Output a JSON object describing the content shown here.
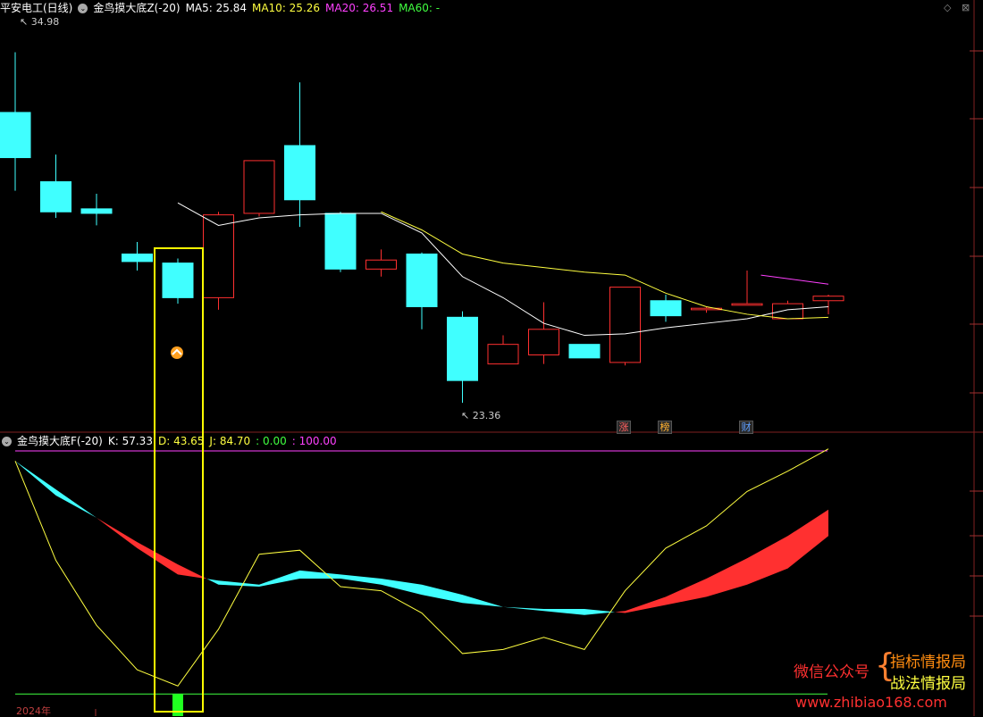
{
  "header": {
    "stock": "平安电工(日线)",
    "indicator": "金鸟摸大底Z(-20)",
    "ma5_label": "MA5: 25.84",
    "ma10_label": "MA10: 25.26",
    "ma20_label": "MA20: 26.51",
    "ma60_label": "MA60: -"
  },
  "sub_header": {
    "indicator": "金鸟摸大底F(-20)",
    "k_label": "K: 57.33",
    "d_label": "D: 43.65",
    "j_label": "J: 84.70",
    "zero_label": ": 0.00",
    "hundred_label": ": 100.00"
  },
  "price_labels": {
    "high": "34.98",
    "low": "23.36"
  },
  "badges": [
    {
      "text": "涨",
      "color": "#ff6060"
    },
    {
      "text": "榜",
      "color": "#ffb030"
    },
    {
      "text": "财",
      "color": "#60a0ff"
    }
  ],
  "date_label": "2024年",
  "watermark": {
    "wechat": "微信公众号",
    "line1": "指标情报局",
    "line2": "战法情报局",
    "url": "www.zhibiao168.com"
  },
  "colors": {
    "up": "#ff3030",
    "down": "#40ffff",
    "ma5": "#ffffff",
    "ma10": "#ffff40",
    "ma20": "#ff40ff",
    "ma60": "#40ff40",
    "highlight": "#ffff00"
  },
  "chart_data": {
    "type": "candlestick",
    "title": "平安电工(日线)",
    "ylim": [
      22.8,
      36.2
    ],
    "candles": [
      {
        "o": 33.0,
        "h": 35.0,
        "l": 30.4,
        "c": 31.5
      },
      {
        "o": 30.7,
        "h": 31.6,
        "l": 29.5,
        "c": 29.7
      },
      {
        "o": 29.8,
        "h": 30.3,
        "l": 29.25,
        "c": 29.65
      },
      {
        "o": 28.3,
        "h": 28.7,
        "l": 27.75,
        "c": 28.05
      },
      {
        "o": 28.0,
        "h": 28.15,
        "l": 26.65,
        "c": 26.85
      },
      {
        "o": 26.85,
        "h": 29.7,
        "l": 26.45,
        "c": 29.6
      },
      {
        "o": 29.65,
        "h": 31.4,
        "l": 29.55,
        "c": 31.4
      },
      {
        "o": 31.9,
        "h": 34.0,
        "l": 29.2,
        "c": 30.1
      },
      {
        "o": 29.65,
        "h": 29.7,
        "l": 27.7,
        "c": 27.8
      },
      {
        "o": 27.8,
        "h": 28.45,
        "l": 27.55,
        "c": 28.1
      },
      {
        "o": 28.3,
        "h": 28.35,
        "l": 25.8,
        "c": 26.55
      },
      {
        "o": 26.2,
        "h": 26.4,
        "l": 23.36,
        "c": 24.1
      },
      {
        "o": 24.65,
        "h": 25.6,
        "l": 24.65,
        "c": 25.3
      },
      {
        "o": 24.95,
        "h": 26.7,
        "l": 24.65,
        "c": 25.8
      },
      {
        "o": 25.3,
        "h": 25.3,
        "l": 24.85,
        "c": 24.85
      },
      {
        "o": 24.7,
        "h": 27.2,
        "l": 24.6,
        "c": 27.2
      },
      {
        "o": 26.75,
        "h": 26.95,
        "l": 26.05,
        "c": 26.25
      },
      {
        "o": 26.45,
        "h": 26.55,
        "l": 26.35,
        "c": 26.5
      },
      {
        "o": 26.6,
        "h": 27.75,
        "l": 26.6,
        "c": 26.65
      },
      {
        "o": 26.15,
        "h": 26.75,
        "l": 26.15,
        "c": 26.65
      },
      {
        "o": 26.75,
        "h": 26.95,
        "l": 26.3,
        "c": 26.9
      }
    ],
    "ma5": [
      null,
      null,
      null,
      null,
      30.0,
      29.25,
      29.5,
      29.6,
      29.65,
      29.65,
      29.0,
      27.55,
      26.85,
      26.0,
      25.6,
      25.65,
      25.85,
      26.0,
      26.15,
      26.45,
      26.55
    ],
    "ma10": [
      null,
      null,
      null,
      null,
      null,
      null,
      null,
      null,
      null,
      29.7,
      29.1,
      28.3,
      28.0,
      27.85,
      27.7,
      27.6,
      27.0,
      26.55,
      26.3,
      26.15,
      26.2
    ],
    "ma20_segment": [
      [
        19,
        27.6
      ],
      [
        20,
        27.3
      ]
    ],
    "kdj": {
      "ylim": [
        -5,
        60
      ],
      "k": [
        57.5,
        49,
        43.5,
        37.5,
        32,
        27,
        26.5,
        28.5,
        28.5,
        27,
        24.5,
        22.5,
        21.5,
        20.5,
        19.5,
        20.5,
        24,
        28.5,
        33.5,
        39,
        45.5
      ],
      "d": [
        57.5,
        50.5,
        43.5,
        36,
        29.5,
        28,
        27,
        30.5,
        29.5,
        28.5,
        27,
        24.5,
        21.5,
        21,
        21,
        20,
        22,
        24,
        27,
        31,
        39
      ],
      "j": [
        57.5,
        33,
        17,
        6,
        2,
        16,
        34.5,
        35.5,
        26.5,
        25.5,
        20,
        10,
        11,
        14,
        11,
        25.5,
        36,
        41.5,
        50,
        55,
        60.5
      ],
      "green_bar_index": 4,
      "green_bar_range": [
        0,
        -5.5
      ],
      "ref_lines": [
        100,
        0
      ]
    }
  }
}
